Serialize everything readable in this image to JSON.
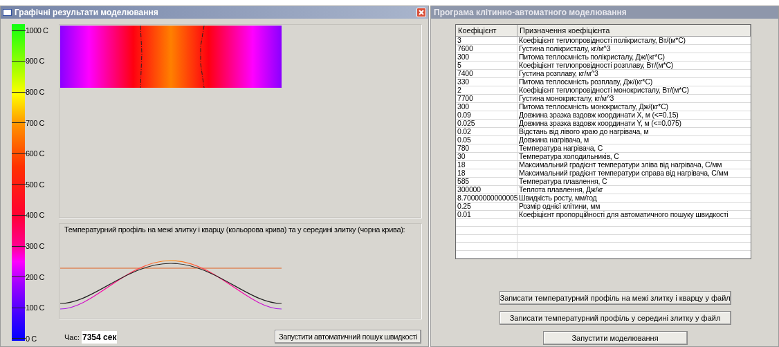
{
  "left_window": {
    "title": "Графічні результати моделювання",
    "scale_labels": [
      "1000 C",
      "900 C",
      "800 C",
      "700 C",
      "600 C",
      "500 C",
      "400 C",
      "300 C",
      "200 C",
      "100 C",
      "0 C"
    ],
    "profile_title": "Температурний профіль на межі злитку і кварцу (кольорова крива) та у середині злитку (чорна крива):",
    "time_label": "Час:",
    "time_value": "7354 сек",
    "button": "Запустити автоматичний пошук швидкості"
  },
  "right_window": {
    "title": "Програма клітинно-автоматного моделювання",
    "table": {
      "columns": [
        "Коефіцієнт",
        "Призначення коефіцієнта"
      ],
      "rows": [
        [
          "3",
          "Коефіцієнт теплопровідності полікристалу, Вт/(м*С)"
        ],
        [
          "7600",
          "Густина полікристалу, кг/м^3"
        ],
        [
          "300",
          "Питома теплоємність полікристалу, Дж/(кг*С)"
        ],
        [
          "5",
          "Коефіцієнт теплопровідності розплаву, Вт/(м*С)"
        ],
        [
          "7400",
          "Густина розплаву, кг/м^3"
        ],
        [
          "330",
          "Питома теплоємність розплаву, Дж/(кг*С)"
        ],
        [
          "2",
          "Коефіцієнт теплопровідності монокристалу, Вт/(м*С)"
        ],
        [
          "7700",
          "Густина монокристалу, кг/м^3"
        ],
        [
          "300",
          "Питома теплоємність монокристалу, Дж/(кг*С)"
        ],
        [
          "0.09",
          "Довжина зразка вздовж координати X, м (<=0.15)"
        ],
        [
          "0.025",
          "Довжина зразка вздовж координати Y, м (<=0.075)"
        ],
        [
          "0.02",
          "Відстань від лівого краю до нагрівача, м"
        ],
        [
          "0.05",
          "Довжина нагрівача, м"
        ],
        [
          "780",
          "Температура нагрівача, С"
        ],
        [
          "30",
          "Температура холодильників, С"
        ],
        [
          "18",
          "Максимальний градієнт температури зліва від нагрівача, С/мм"
        ],
        [
          "18",
          "Максимальний градієнт температури справа від нагрівача, С/мм"
        ],
        [
          "585",
          "Температура плавлення, С"
        ],
        [
          "300000",
          "Теплота плавлення, Дж/кг"
        ],
        [
          "8.70000000000005",
          "Швидкість росту, мм/год"
        ],
        [
          "0.25",
          "Розмір однієї клітини, мм"
        ],
        [
          "0.01",
          "Коефіцієнт пропорційності для автоматичного пошуку швидкості"
        ]
      ]
    },
    "buttons": [
      {
        "label": "Записати температурний профіль на межі злитку і кварцу у файл",
        "kind": "wide"
      },
      {
        "label": "Записати температурний профіль у середині злитку у файл",
        "kind": "wide"
      },
      {
        "label": "Запустити моделювання",
        "kind": "narrow"
      }
    ]
  }
}
